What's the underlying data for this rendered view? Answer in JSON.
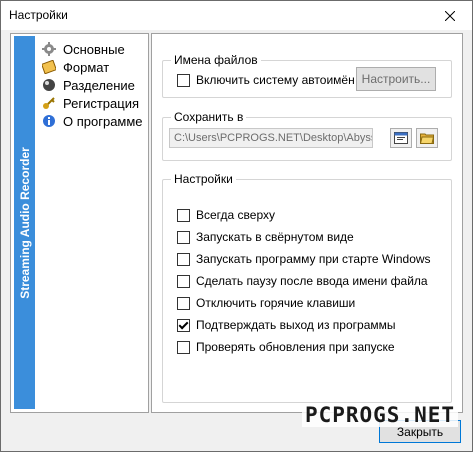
{
  "window": {
    "title": "Настройки"
  },
  "side_strip": {
    "text": "Streaming Audio Recorder",
    "color": "#3b8edb"
  },
  "nav": {
    "items": [
      {
        "label": "Основные",
        "icon": "gear-icon"
      },
      {
        "label": "Формат",
        "icon": "note-icon"
      },
      {
        "label": "Разделение",
        "icon": "split-icon"
      },
      {
        "label": "Регистрация",
        "icon": "key-icon"
      },
      {
        "label": "О программе",
        "icon": "info-icon"
      }
    ]
  },
  "filenames_group": {
    "title": "Имена файлов",
    "auto_name_label": "Включить систему автоимён",
    "auto_name_checked": false,
    "configure_button": "Настроить..."
  },
  "save_group": {
    "title": "Сохранить в",
    "path_value": "C:\\Users\\PCPROGS.NET\\Desktop\\Abyssm",
    "browse_icon": "browse-folder-icon",
    "open_icon": "open-folder-icon"
  },
  "settings_group": {
    "title": "Настройки",
    "options": [
      {
        "label": "Всегда сверху",
        "checked": false
      },
      {
        "label": "Запускать в свёрнутом виде",
        "checked": false
      },
      {
        "label": "Запускать программу при старте Windows",
        "checked": false
      },
      {
        "label": "Сделать паузу после ввода имени файла",
        "checked": false
      },
      {
        "label": "Отключить горячие клавиши",
        "checked": false
      },
      {
        "label": "Подтверждать выход из программы",
        "checked": true
      },
      {
        "label": "Проверять обновления при запуске",
        "checked": false
      }
    ]
  },
  "footer": {
    "close_button": "Закрыть"
  },
  "watermark": {
    "text": "PCPROGS.NET"
  }
}
